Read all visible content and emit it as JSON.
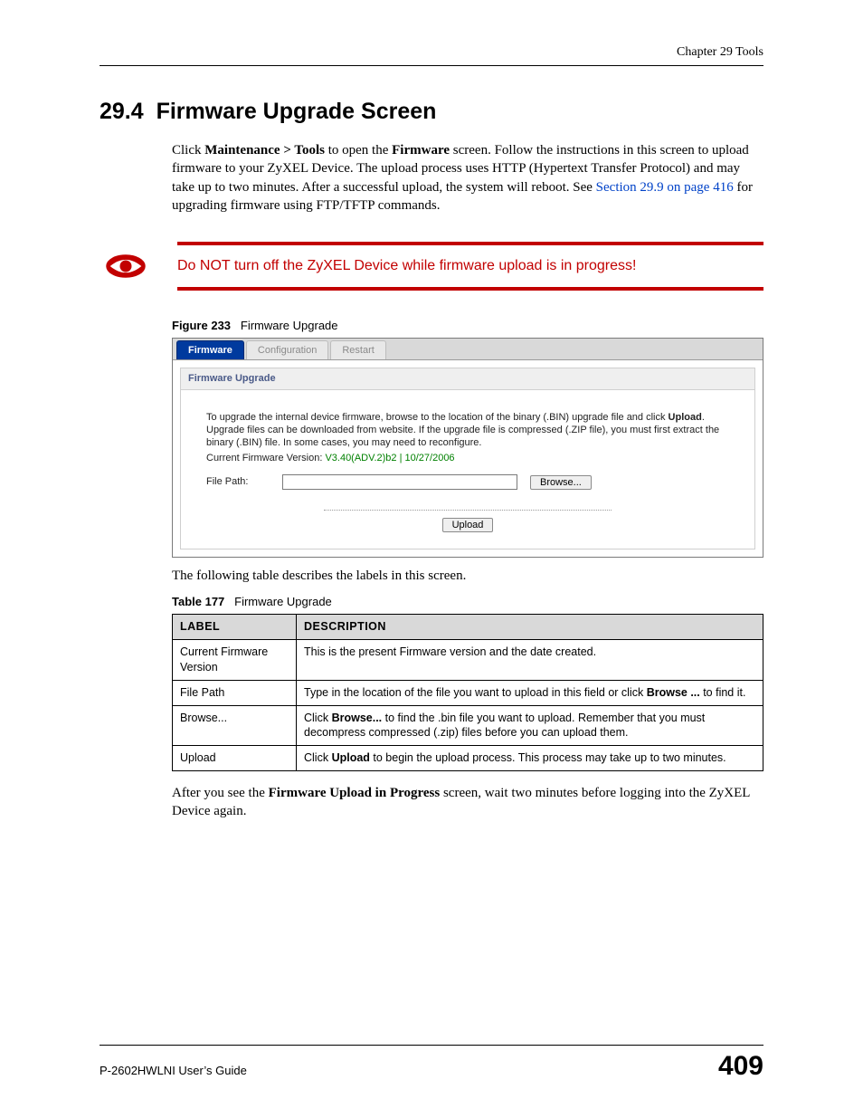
{
  "header": {
    "chapter": "Chapter 29 Tools"
  },
  "section": {
    "number": "29.4",
    "title": "Firmware Upgrade Screen",
    "intro_pre": "Click ",
    "intro_bold1": "Maintenance > Tools",
    "intro_mid1": " to open the ",
    "intro_bold2": "Firmware",
    "intro_post": " screen. Follow the instructions in this screen to upload firmware to your ZyXEL Device. The upload process uses HTTP (Hypertext Transfer Protocol) and may take up to two minutes. After a successful upload, the system will reboot. See ",
    "intro_link": "Section 29.9 on page 416",
    "intro_end": " for upgrading firmware using FTP/TFTP commands."
  },
  "warning": {
    "text": "Do NOT turn off the ZyXEL Device while firmware upload is in progress!"
  },
  "figure": {
    "num": "Figure 233",
    "title": "Firmware Upgrade",
    "tabs": [
      "Firmware",
      "Configuration",
      "Restart"
    ],
    "panel_title": "Firmware Upgrade",
    "instr_pre": "To upgrade the internal device firmware, browse to the location of the binary (.BIN) upgrade file and click ",
    "instr_bold": "Upload",
    "instr_post": ". Upgrade files can be downloaded from website. If the upgrade file is compressed (.ZIP file), you must first extract the binary (.BIN) file. In some cases, you may need to reconfigure.",
    "ver_label": "Current Firmware Version: ",
    "ver_value": "V3.40(ADV.2)b2 | 10/27/2006",
    "filepath_label": "File Path:",
    "browse_label": "Browse...",
    "upload_label": "Upload"
  },
  "body2": {
    "line": "The following table describes the labels in this screen."
  },
  "table": {
    "num": "Table 177",
    "title": "Firmware Upgrade",
    "head_label": "LABEL",
    "head_desc": "DESCRIPTION",
    "rows": [
      {
        "label": "Current Firmware Version",
        "desc_pre": "This is the present Firmware version and the date created.",
        "desc_bold": "",
        "desc_post": ""
      },
      {
        "label": "File Path",
        "desc_pre": "Type in the location of the file you want to upload in this field or click ",
        "desc_bold": "Browse ...",
        "desc_post": " to find it."
      },
      {
        "label": "Browse...",
        "desc_pre": "Click ",
        "desc_bold": "Browse...",
        "desc_post": " to find the .bin file you want to upload. Remember that you must decompress compressed (.zip) files before you can upload them."
      },
      {
        "label": "Upload",
        "desc_pre": "Click ",
        "desc_bold": "Upload",
        "desc_post": " to begin the upload process. This process may take up to two minutes."
      }
    ]
  },
  "body3": {
    "pre": "After you see the ",
    "bold": "Firmware Upload in Progress",
    "post": " screen, wait two minutes before logging into the ZyXEL Device again."
  },
  "footer": {
    "guide": "P-2602HWLNI User’s Guide",
    "page": "409"
  }
}
